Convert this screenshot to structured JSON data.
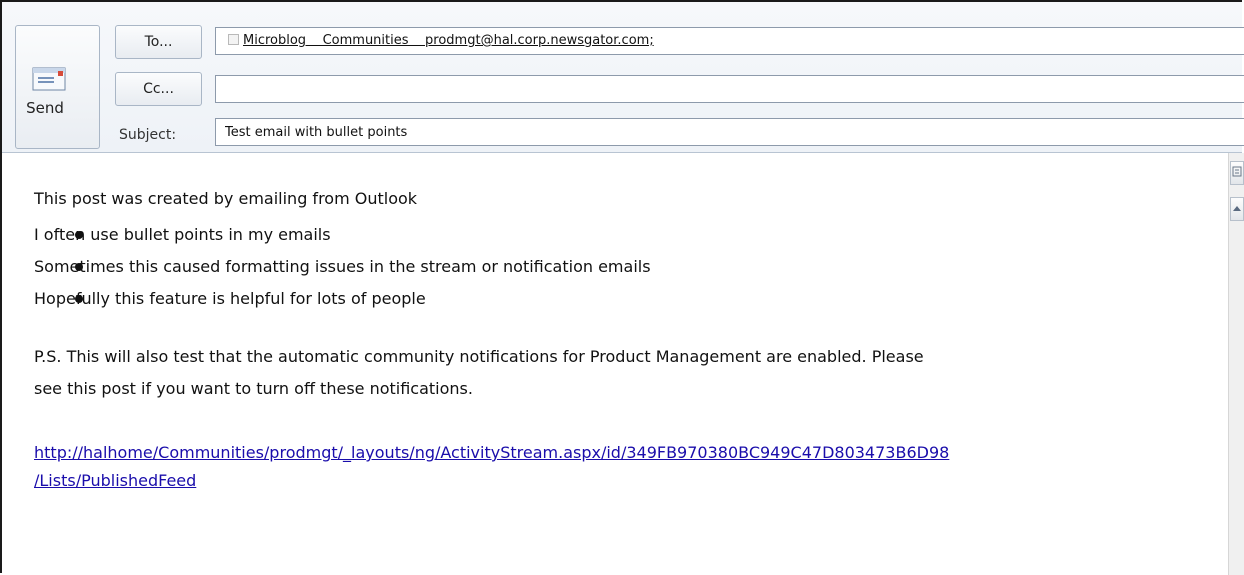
{
  "header": {
    "send_label": "Send",
    "to_button": "To...",
    "cc_button": "Cc...",
    "subject_label": "Subject:",
    "to_value": "Microblog    Communities    prodmgt@hal.corp.newsgator.com;",
    "cc_value": "",
    "subject_value": "Test email with bullet points"
  },
  "body": {
    "intro": "This post was created by emailing from Outlook",
    "bullets": [
      "I often use bullet points in my emails",
      "Sometimes this caused formatting issues in the stream or notification emails",
      "Hopefully this feature is helpful for lots of people"
    ],
    "ps_line1": "P.S.  This will also test that the automatic community notifications for Product Management are enabled.  Please",
    "ps_line2": "see this post if you want to turn off these notifications.",
    "link_line1": "http://halhome/Communities/prodmgt/_layouts/ng/ActivityStream.aspx/id/349FB970380BC949C47D803473B6D98",
    "link_line2": "/Lists/PublishedFeed"
  },
  "icons": {
    "send": "send-envelope-icon",
    "scroll_up": "scroll-up-arrow-icon",
    "ruler": "ruler-toggle-icon"
  },
  "colors": {
    "link": "#1a0dab",
    "header_bg": "#eef2f7",
    "border": "#8d9aab"
  }
}
